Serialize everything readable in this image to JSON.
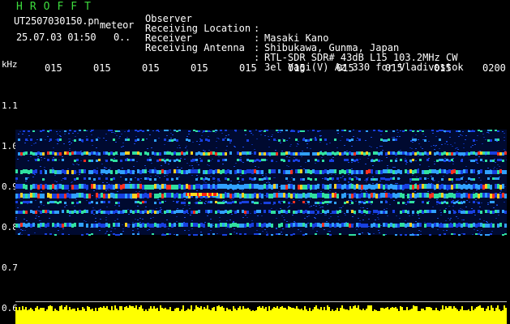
{
  "header": {
    "brand": "HROFFT",
    "filename": "UT2507030150.pn",
    "mode": "meteor",
    "datetime": "25.07.03 01:50",
    "extra": "0.."
  },
  "info": [
    {
      "key": "Observer",
      "value": "Masaki Kano"
    },
    {
      "key": "Receiving Location",
      "value": "Shibukawa, Gunma, Japan"
    },
    {
      "key": "Receiver",
      "value": "RTL-SDR SDR# 43dB L15 103.2MHz CW"
    },
    {
      "key": "Receiving Antenna",
      "value": "3el Yagi(V) Az 330 for Vladivostok"
    }
  ],
  "colon": ":",
  "axis": {
    "unit": "kHz",
    "time_ticks": [
      "015",
      "015",
      "015",
      "015",
      "015",
      "015",
      "015",
      "015",
      "015",
      "0200"
    ],
    "freq_ticks": [
      "1.1",
      "1.0",
      "0.9",
      "0.8",
      "0.7",
      "0.6"
    ]
  },
  "colors": {
    "background": "#000000",
    "brand": "#3ddc3d",
    "noise_floor": "#ffff00",
    "band_low": "#1030d0",
    "band_high": "#ff2020"
  }
}
